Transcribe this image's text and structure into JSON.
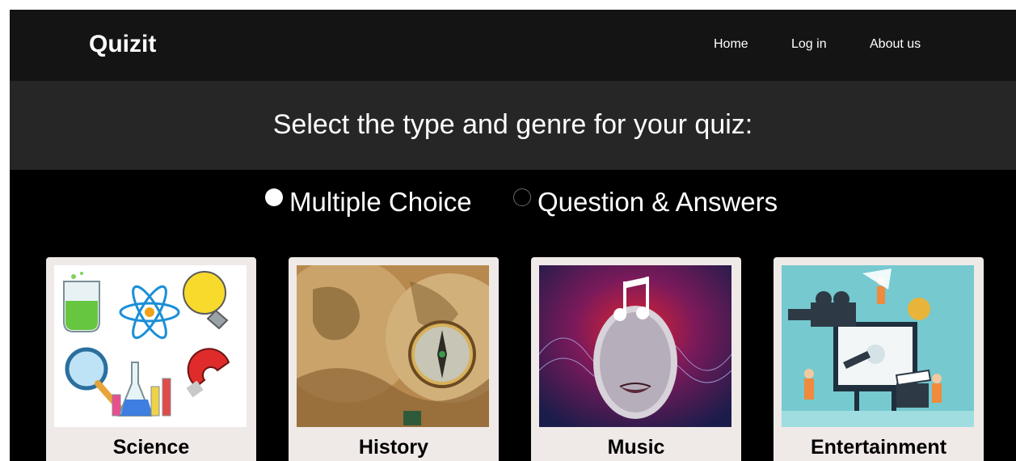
{
  "nav": {
    "brand": "Quizit",
    "links": [
      {
        "label": "Home"
      },
      {
        "label": "Log in"
      },
      {
        "label": "About us"
      }
    ]
  },
  "heading": "Select the type and genre for your quiz:",
  "quiz_types": [
    {
      "label": "Multiple Choice",
      "selected": true
    },
    {
      "label": "Question & Answers",
      "selected": false
    }
  ],
  "genres": [
    {
      "label": "Science",
      "icon": "science-icons-image"
    },
    {
      "label": "History",
      "icon": "map-compass-image"
    },
    {
      "label": "Music",
      "icon": "music-face-image"
    },
    {
      "label": "Entertainment",
      "icon": "film-production-image"
    }
  ],
  "colors": {
    "navbar_bg": "#141414",
    "heading_bg": "#262626",
    "page_bg": "#000000",
    "card_bg": "#efe9e7"
  }
}
